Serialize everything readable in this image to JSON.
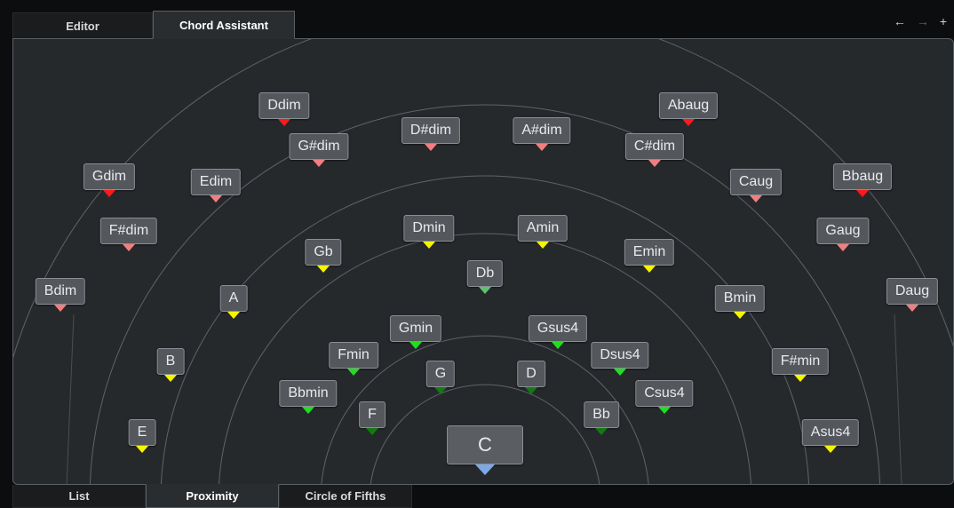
{
  "tabs": {
    "editor": "Editor",
    "chord_assistant": "Chord Assistant"
  },
  "icons": {
    "back": "←",
    "forward": "→",
    "add": "+"
  },
  "bottom_tabs": {
    "list": "List",
    "proximity": "Proximity",
    "circle_of_fifths": "Circle of Fifths"
  },
  "center_chord": {
    "label": "C",
    "marker_color": "#7fa8e6"
  },
  "chords": [
    {
      "label": "Ddim",
      "color": "#ff1a1a"
    },
    {
      "label": "Abaug",
      "color": "#ff1a1a"
    },
    {
      "label": "Gdim",
      "color": "#ff1a1a"
    },
    {
      "label": "Bbaug",
      "color": "#ff1a1a"
    },
    {
      "label": "G#dim",
      "color": "#f08080"
    },
    {
      "label": "D#dim",
      "color": "#f08080"
    },
    {
      "label": "A#dim",
      "color": "#f08080"
    },
    {
      "label": "C#dim",
      "color": "#f08080"
    },
    {
      "label": "Edim",
      "color": "#f08080"
    },
    {
      "label": "Caug",
      "color": "#f08080"
    },
    {
      "label": "F#dim",
      "color": "#f08080"
    },
    {
      "label": "Gaug",
      "color": "#f08080"
    },
    {
      "label": "Bdim",
      "color": "#f08080"
    },
    {
      "label": "Daug",
      "color": "#f08080"
    },
    {
      "label": "Dmin",
      "color": "#f5f500"
    },
    {
      "label": "Amin",
      "color": "#f5f500"
    },
    {
      "label": "Gb",
      "color": "#f5f500"
    },
    {
      "label": "Emin",
      "color": "#f5f500"
    },
    {
      "label": "A",
      "color": "#f5f500"
    },
    {
      "label": "Bmin",
      "color": "#f5f500"
    },
    {
      "label": "B",
      "color": "#f5f500"
    },
    {
      "label": "F#min",
      "color": "#f5f500"
    },
    {
      "label": "E",
      "color": "#f5f500"
    },
    {
      "label": "Asus4",
      "color": "#f5f500"
    },
    {
      "label": "Db",
      "color": "#5fc06f"
    },
    {
      "label": "Gmin",
      "color": "#22dd22"
    },
    {
      "label": "Gsus4",
      "color": "#22dd22"
    },
    {
      "label": "Fmin",
      "color": "#22dd22"
    },
    {
      "label": "Dsus4",
      "color": "#22dd22"
    },
    {
      "label": "Bbmin",
      "color": "#22dd22"
    },
    {
      "label": "Csus4",
      "color": "#22dd22"
    },
    {
      "label": "G",
      "color": "#127a12"
    },
    {
      "label": "D",
      "color": "#127a12"
    },
    {
      "label": "F",
      "color": "#127a12"
    },
    {
      "label": "Bb",
      "color": "#127a12"
    }
  ]
}
